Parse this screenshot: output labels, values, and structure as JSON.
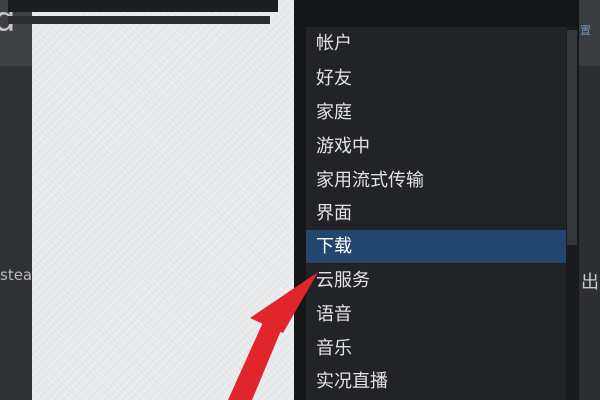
{
  "menu": {
    "items": [
      {
        "label": "帐户",
        "selected": false
      },
      {
        "label": "好友",
        "selected": false
      },
      {
        "label": "家庭",
        "selected": false
      },
      {
        "label": "游戏中",
        "selected": false
      },
      {
        "label": "家用流式传输",
        "selected": false
      },
      {
        "label": "界面",
        "selected": false
      },
      {
        "label": "下载",
        "selected": true
      },
      {
        "label": "云服务",
        "selected": false
      },
      {
        "label": "语音",
        "selected": false
      },
      {
        "label": "音乐",
        "selected": false
      },
      {
        "label": "实况直播",
        "selected": false
      }
    ]
  },
  "background": {
    "top_left_text": "d",
    "left_text": "stea",
    "right_top_text": "置",
    "right_mid_text": "出"
  },
  "colors": {
    "selected_bg": "#23466e",
    "menu_bg": "#222326",
    "arrow": "#e0252b"
  }
}
